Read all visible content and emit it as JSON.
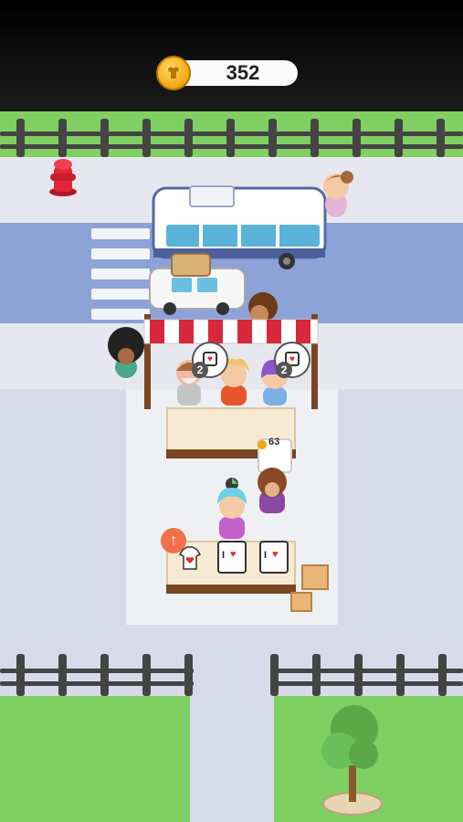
{
  "hud": {
    "coin_icon": "coin-icon",
    "coin_count": "352"
  },
  "stall": {
    "queue": [
      {
        "request_icon": "tshirt-heart-icon",
        "quantity": "2"
      },
      {
        "request_icon": "tshirt-heart-icon",
        "quantity": "2"
      }
    ]
  },
  "checkout": {
    "coin_amount": "63"
  },
  "shelf": {
    "upgrade_icon": "arrow-up-icon",
    "shirt_label": "I"
  },
  "colors": {
    "grass": "#7fcf62",
    "road": "#8da2d6",
    "sidewalk": "#e7e8ef",
    "awning_red": "#d8283c",
    "coin_gold": "#f0a810"
  }
}
